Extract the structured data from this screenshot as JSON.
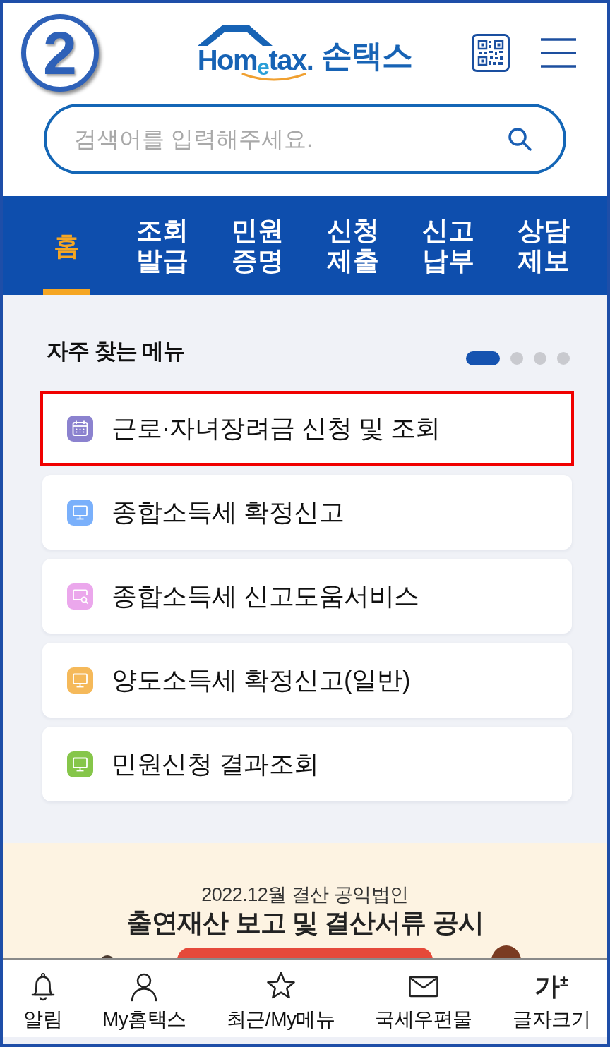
{
  "step_badge": "2",
  "header": {
    "logo": {
      "wordmark": "Hom$_{e}$tax.",
      "name": "손택스"
    },
    "search": {
      "placeholder": "검색어를 입력해주세요."
    }
  },
  "nav_tabs": [
    {
      "label": "홈",
      "selected": true
    },
    {
      "label": "조회\n발급",
      "selected": false
    },
    {
      "label": "민원\n증명",
      "selected": false
    },
    {
      "label": "신청\n제출",
      "selected": false
    },
    {
      "label": "신고\n납부",
      "selected": false
    },
    {
      "label": "상담\n제보",
      "selected": false
    }
  ],
  "favorites": {
    "title": "자주 찾는 메뉴",
    "page_dots": [
      {
        "selected": true
      },
      {
        "selected": false
      },
      {
        "selected": false
      },
      {
        "selected": false
      }
    ],
    "items": [
      {
        "label": "근로·자녀장려금 신청 및 조회",
        "kind": "calendar",
        "color": "#8b82cf",
        "highlighted": true
      },
      {
        "label": "종합소득세 확정신고",
        "kind": "monitor",
        "color": "#7ab0fb",
        "highlighted": false
      },
      {
        "label": "종합소득세 신고도움서비스",
        "kind": "magnifier",
        "color": "#eba7ec",
        "highlighted": false
      },
      {
        "label": "양도소득세 확정신고(일반)",
        "kind": "monitor",
        "color": "#f5b95a",
        "highlighted": false
      },
      {
        "label": "민원신청 결과조회",
        "kind": "monitor",
        "color": "#86c64a",
        "highlighted": false
      }
    ]
  },
  "banner": {
    "subtitle": "2022.12월 결산 공익법인",
    "title": "출연재산 보고 및 결산서류 공시"
  },
  "bottom_nav": [
    {
      "label": "알림",
      "kind": "bell"
    },
    {
      "label": "My홈택스",
      "kind": "person"
    },
    {
      "label": "최근/My메뉴",
      "kind": "star"
    },
    {
      "label": "국세우편물",
      "kind": "envelope"
    },
    {
      "label": "글자크기",
      "kind": "glyph",
      "glyph": "가$^{±}$"
    }
  ]
}
